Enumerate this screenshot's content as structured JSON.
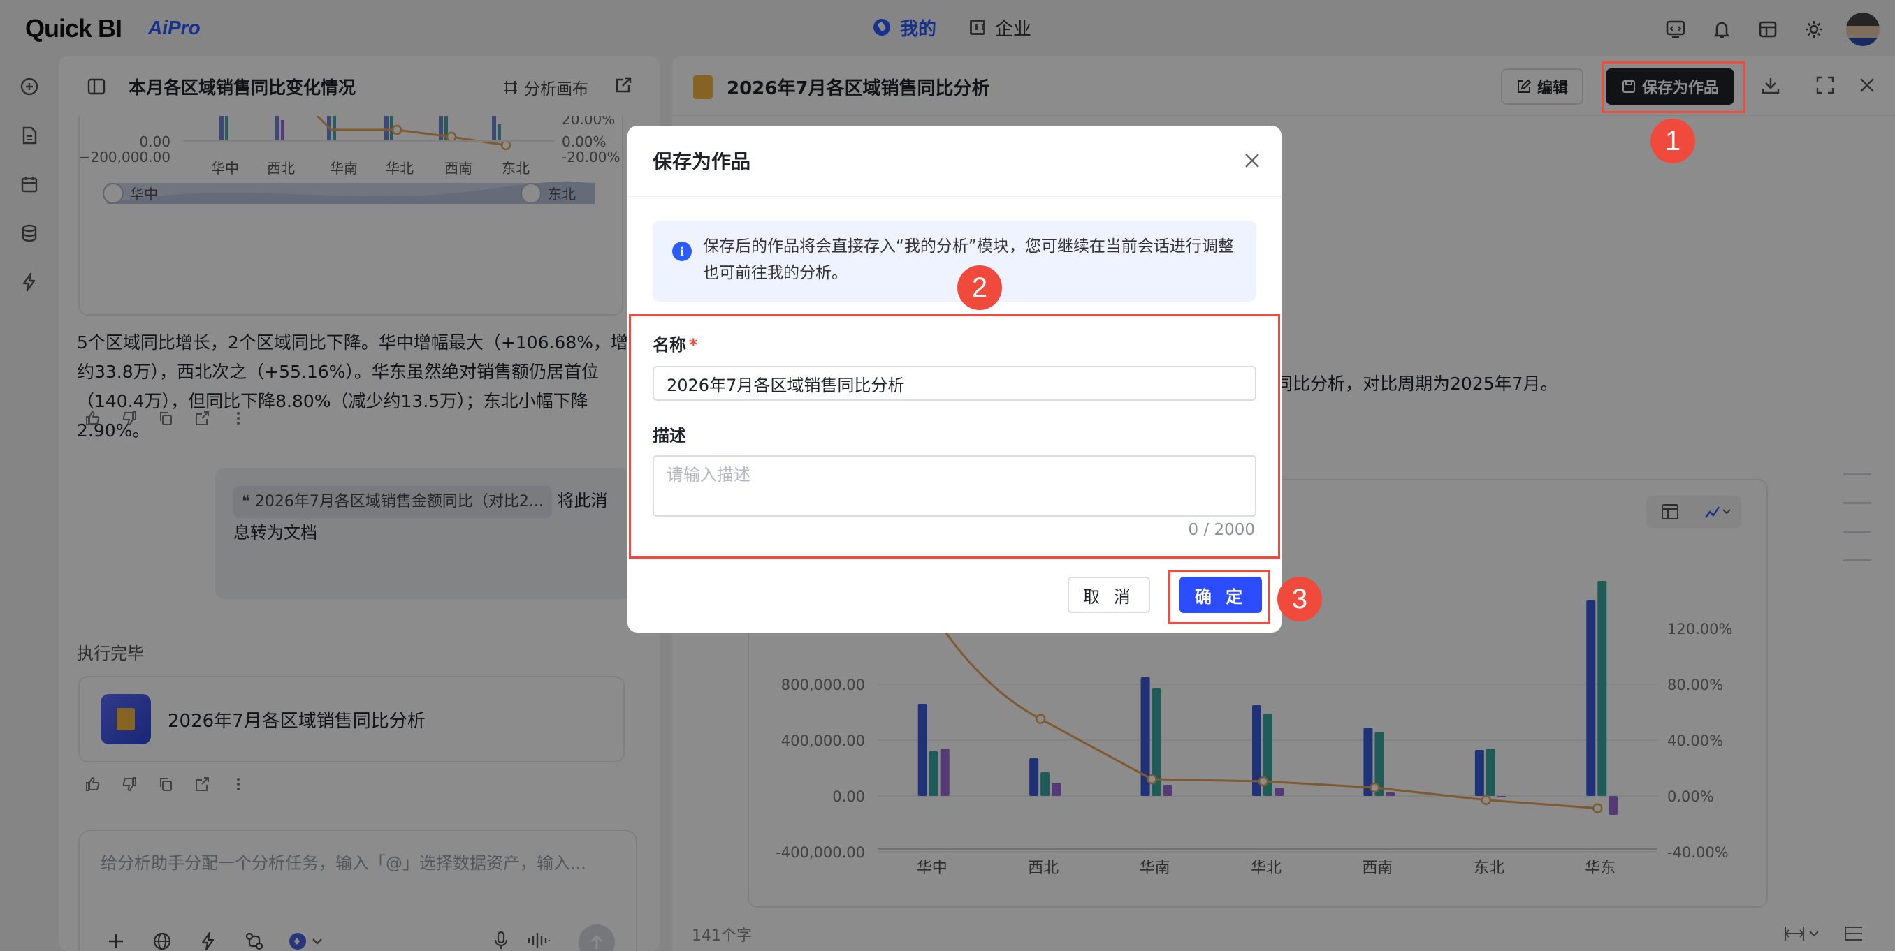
{
  "app": {
    "logo": "Quick BI",
    "logo_badge": "AiPro"
  },
  "top_nav": [
    {
      "label": "我的",
      "active": true,
      "icon": "mine-icon"
    },
    {
      "label": "企业",
      "active": false,
      "icon": "building-icon"
    }
  ],
  "top_icons": [
    "screen-icon",
    "bell-icon",
    "layout-icon",
    "gear-icon"
  ],
  "left_panel": {
    "title": "本月各区域销售同比变化情况",
    "canvas_label": "分析画布",
    "mini_chart": {
      "y_left_ticks": [
        "0.00",
        "−200,000.00"
      ],
      "y_right_ticks": [
        "20.00%",
        "0.00%",
        "-20.00%"
      ],
      "categories": [
        "华中",
        "西北",
        "华南",
        "华北",
        "西南",
        "东北"
      ],
      "slider_start": "华中",
      "slider_end": "东北"
    },
    "summary": "5个区域同比增长，2个区域同比下降。华中增幅最大（+106.68%，增加约33.8万），西北次之（+55.16%）。华东虽然绝对销售额仍居首位（140.4万），但同比下降8.80%（减少约13.5万）；东北小幅下降2.90%。",
    "quote_chip": "2026年7月各区域销售金额同比（对比2...",
    "quote_text": "将此消息转为文档",
    "exec_status": "执行完毕",
    "doc_card_title": "2026年7月各区域销售同比分析",
    "input_placeholder": "给分析助手分配一个分析任务，输入「@」选择数据资产，输入..."
  },
  "right_panel": {
    "title": "2026年7月各区域销售同比分析",
    "edit_label": "编辑",
    "save_label": "保存为作品",
    "body_text": "行同比分析，对比周期为2025年7月。",
    "word_count": "141个字"
  },
  "chart_data": {
    "type": "bar",
    "categories": [
      "华中",
      "西北",
      "华南",
      "华北",
      "西南",
      "东北",
      "华东"
    ],
    "series": [
      {
        "name": "",
        "values": [
          660000,
          270000,
          850000,
          650000,
          490000,
          330000,
          1400000
        ],
        "color": "#3a5bd9"
      },
      {
        "name": "",
        "values": [
          320000,
          170000,
          770000,
          590000,
          460000,
          340000,
          1540000
        ],
        "color": "#3aa8a0"
      },
      {
        "name": "",
        "values": [
          338000,
          95000,
          80000,
          60000,
          25000,
          -10000,
          -135000
        ],
        "color": "#9b6bd6"
      }
    ],
    "line_series": {
      "name": "",
      "values": [
        106.68,
        55.16,
        12,
        10.5,
        6,
        -2.9,
        -8.8
      ],
      "color": "#e8a45a"
    },
    "ylim_left": [
      -400000,
      1200000
    ],
    "ylim_right": [
      -40,
      120
    ],
    "y_left_ticks": [
      "800,000.00",
      "400,000.00",
      "0.00",
      "-400,000.00"
    ],
    "y_right_ticks": [
      "120.00%",
      "80.00%",
      "40.00%",
      "0.00%",
      "-40.00%"
    ],
    "grid": true
  },
  "modal": {
    "title": "保存为作品",
    "info": "保存后的作品将会直接存入“我的分析”模块，您可继续在当前会话进行调整也可前往我的分析。",
    "name_label": "名称",
    "required_mark": "*",
    "name_value": "2026年7月各区域销售同比分析",
    "desc_label": "描述",
    "desc_placeholder": "请输入描述",
    "char_count": "0 / 2000",
    "cancel_label": "取 消",
    "ok_label": "确 定"
  },
  "annotations": [
    "1",
    "2",
    "3"
  ],
  "colors": {
    "accent": "#2b4cff",
    "highlight": "#f24a3d",
    "dark_button": "#1f2329"
  }
}
